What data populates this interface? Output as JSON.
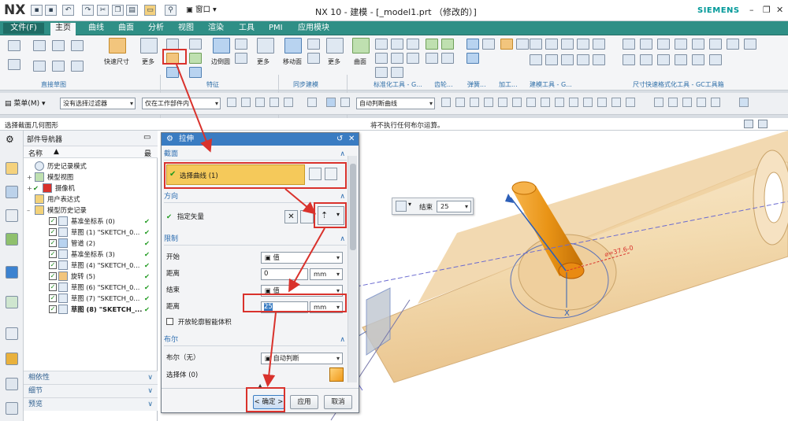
{
  "title": {
    "logo": "NX",
    "window_title": "NX 10 - 建模 - [_model1.prt （修改的）]",
    "brand": "SIEMENS",
    "window_menu": "窗口"
  },
  "menubar": {
    "items": [
      "文件(F)",
      "主页",
      "曲线",
      "曲面",
      "分析",
      "视图",
      "渲染",
      "工具",
      "PMI",
      "应用模块"
    ],
    "active": "主页"
  },
  "ribbon": {
    "labels": {
      "quick_dim": "快速尺寸",
      "more1": "更多",
      "edge_blend": "边倒圆",
      "more2": "更多",
      "move_face": "移动面",
      "more3": "更多",
      "surface": "曲面",
      "more4": "更多"
    },
    "groups": [
      "直接草图",
      "特征",
      "同步建模",
      "标准化工具 - G...",
      "齿轮...",
      "弹簧...",
      "加工...",
      "建模工具 - G...",
      "尺寸快速格式化工具 - GC工具箱"
    ]
  },
  "toolbar2": {
    "menu_label": "菜单(M)",
    "filter": "没有选择过滤器",
    "scope": "仅在工作部件内",
    "snap": "自动判断曲线"
  },
  "cues": {
    "left": "选择截面几何图形",
    "right": "将不执行任何布尔运算。"
  },
  "navigator": {
    "title": "部件导航器",
    "col_name": "名称",
    "col_latest": "最",
    "items": [
      {
        "label": "历史记录模式",
        "check": false,
        "status": ""
      },
      {
        "label": "模型视图",
        "check": false,
        "status": ""
      },
      {
        "label": "摄像机",
        "check": true,
        "status": ""
      },
      {
        "label": "用户表达式",
        "check": false,
        "status": ""
      },
      {
        "label": "模型历史记录",
        "check": false,
        "status": ""
      },
      {
        "label": "基准坐标系 (0)",
        "check": true,
        "status": "✔"
      },
      {
        "label": "草图 (1) \"SKETCH_0...",
        "check": true,
        "status": "✔"
      },
      {
        "label": "管道 (2)",
        "check": true,
        "status": "✔"
      },
      {
        "label": "基准坐标系 (3)",
        "check": true,
        "status": "✔"
      },
      {
        "label": "草图 (4) \"SKETCH_0...",
        "check": true,
        "status": "✔"
      },
      {
        "label": "旋转 (5)",
        "check": true,
        "status": "✔"
      },
      {
        "label": "草图 (6) \"SKETCH_0...",
        "check": true,
        "status": "✔"
      },
      {
        "label": "草图 (7) \"SKETCH_0...",
        "check": true,
        "status": "✔"
      },
      {
        "label": "草图 (8) \"SKETCH_...",
        "check": true,
        "status": "✔"
      }
    ],
    "footer": [
      "相依性",
      "细节",
      "预览"
    ]
  },
  "dialog": {
    "title": "拉伸",
    "section_label": "截面",
    "select_curve": "选择曲线 (1)",
    "direction_label": "方向",
    "specify_vector": "指定矢量",
    "limits_label": "限制",
    "start_label": "开始",
    "start_type": "值",
    "start_dist_label": "距离",
    "start_dist": "0",
    "end_label": "结束",
    "end_type": "值",
    "end_dist_label": "距离",
    "end_dist": "25",
    "unit": "mm",
    "open_profile": "开放轮廓智能体积",
    "boolean_label": "布尔",
    "boolean_none": "布尔（无）",
    "boolean_value": "自动判断",
    "select_body": "选择体 (0)",
    "ok": "< 确定 >",
    "apply": "应用",
    "cancel": "取消"
  },
  "floating": {
    "end_label": "结束",
    "end_value": "25"
  },
  "scene": {
    "dim_label": "⌀=37.6-0",
    "axis_x": "X"
  },
  "colors": {
    "accent_teal": "#2f8f86",
    "dialog_title": "#3a7cc2",
    "highlight": "#f5c95a",
    "annotation_red": "#d9322c",
    "model_body": "#f3dbb0",
    "extrusion": "#f0a020"
  }
}
